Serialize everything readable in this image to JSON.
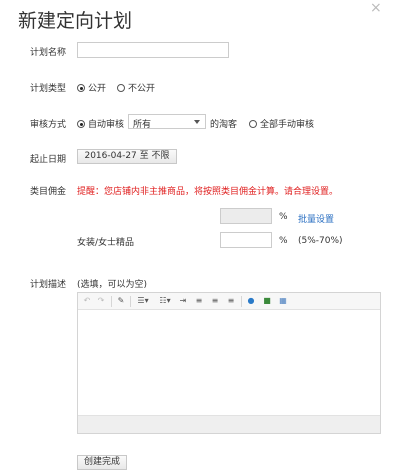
{
  "dialog": {
    "title": "新建定向计划",
    "close_glyph": "×"
  },
  "plan_name": {
    "label": "计划名称",
    "value": ""
  },
  "plan_type": {
    "label": "计划类型",
    "options": [
      "公开",
      "不公开"
    ],
    "selected": "公开"
  },
  "review": {
    "label": "审核方式",
    "auto_label": "自动审核",
    "select_value": "所有",
    "suffix": "的淘客",
    "manual_label": "全部手动审核",
    "selected": "自动审核"
  },
  "dates": {
    "label": "起止日期",
    "button_text": "2016-04-27 至 不限"
  },
  "commission": {
    "label": "类目佣金",
    "warning": "提醒：您店铺内非主推商品，将按照类目佣金计算。请合理设置。",
    "percent_sign": "%",
    "batch_link": "批量设置",
    "category_name": "女装/女士精品",
    "range_hint": "(5%-70%)",
    "row1_value": "",
    "row2_value": ""
  },
  "description": {
    "label": "计划描述",
    "hint": "(选填，可以为空)",
    "toolbar_icons": [
      "undo-icon",
      "redo-icon",
      "clear-format-icon",
      "unordered-list-icon",
      "ordered-list-icon",
      "indent-icon",
      "align-left-icon",
      "align-center-icon",
      "align-right-icon",
      "link-icon",
      "image-icon",
      "table-icon"
    ]
  },
  "submit": {
    "label": "创建完成"
  }
}
